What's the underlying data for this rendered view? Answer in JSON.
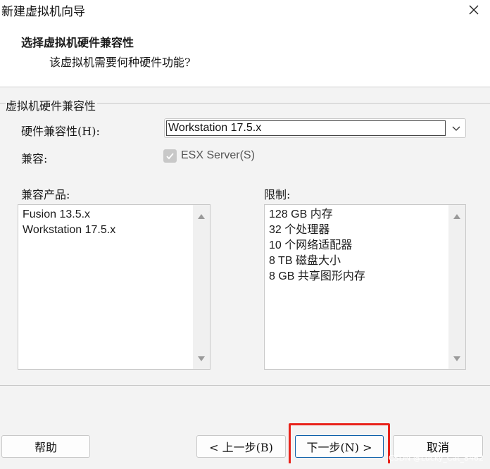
{
  "window": {
    "title": "新建虚拟机向导",
    "close_glyph": "✕"
  },
  "header": {
    "title": "选择虚拟机硬件兼容性",
    "subtitle": "该虚拟机需要何种硬件功能?"
  },
  "group": {
    "legend": "虚拟机硬件兼容性",
    "hardware_label": "硬件兼容性(H):",
    "hardware_value": "Workstation 17.5.x",
    "compat_label": "兼容:",
    "esx_label": "ESX Server(S)",
    "esx_checked": true,
    "esx_enabled": false,
    "products_label": "兼容产品:",
    "products": [
      "Fusion 13.5.x",
      "Workstation 17.5.x"
    ],
    "limits_label": "限制:",
    "limits": [
      "128 GB 内存",
      "32 个处理器",
      "10 个网络适配器",
      "8 TB 磁盘大小",
      "8 GB 共享图形内存"
    ]
  },
  "buttons": {
    "help": "帮助",
    "back": "< 上一步(B)",
    "next": "下一步(N) >",
    "cancel": "取消"
  },
  "watermark": "CSDN @Lucky_Cat_8462",
  "colors": {
    "highlight": "#e8221a",
    "primary_border": "#0a5ea8"
  }
}
